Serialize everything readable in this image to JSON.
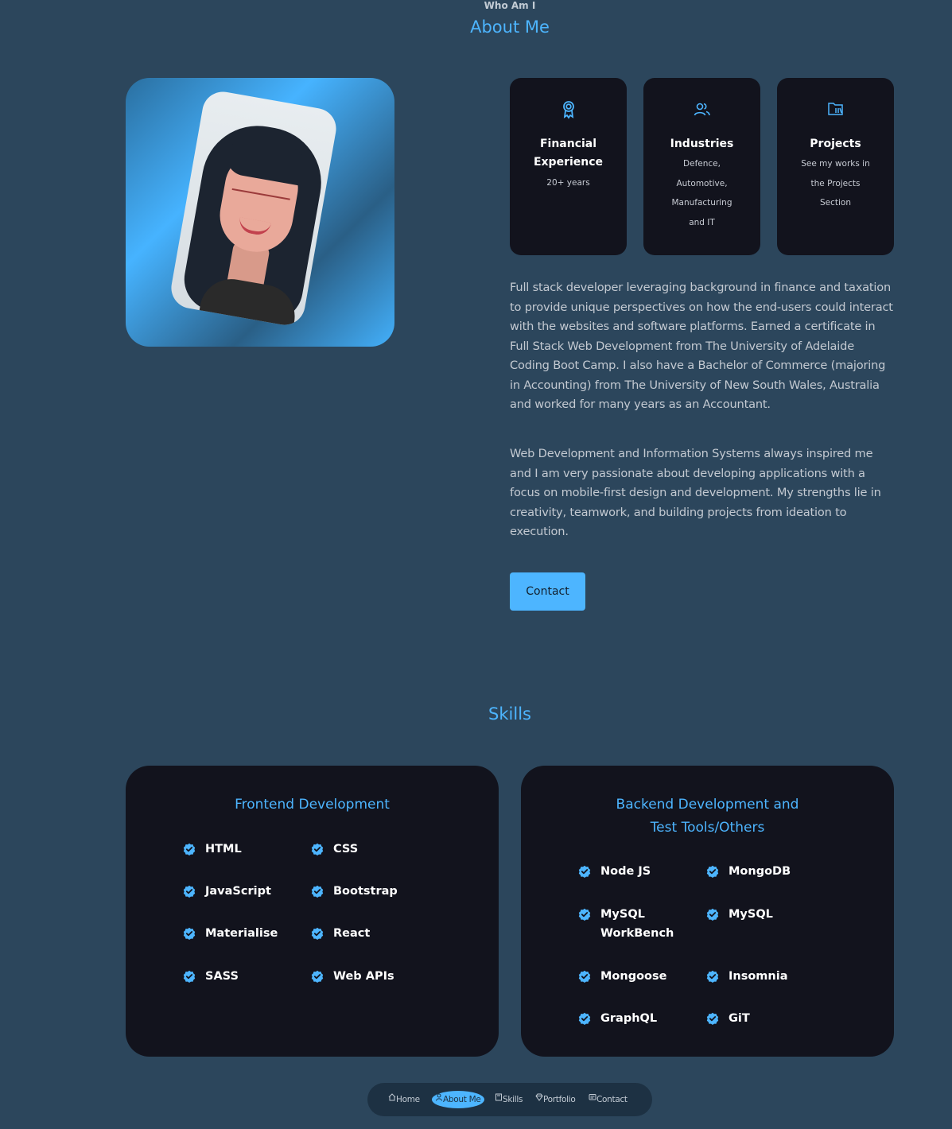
{
  "header": {
    "eyebrow": "Who Am I",
    "title": "About Me"
  },
  "info_cards": [
    {
      "icon": "award-icon",
      "title": "Financial Experience",
      "title_lines": [
        "Financial",
        "Experience"
      ],
      "subtitle": "20+ years",
      "subtitle_lines": [
        "20+ years"
      ]
    },
    {
      "icon": "users-icon",
      "title": "Industries",
      "title_lines": [
        "Industries"
      ],
      "subtitle": "Defence, Automotive, Manufacturing and IT",
      "subtitle_lines": [
        "Defence,",
        "Automotive,",
        "Manufacturing",
        "and IT"
      ]
    },
    {
      "icon": "folder-icon",
      "title": "Projects",
      "title_lines": [
        "Projects"
      ],
      "subtitle": "See my works in the Projects Section",
      "subtitle_lines": [
        "See my works in",
        "the Projects",
        "Section"
      ]
    }
  ],
  "about": {
    "paragraph_1": "Full stack developer leveraging background in finance and taxation to provide unique perspectives on how the end-users could interact with the websites and software platforms. Earned a certificate in Full Stack Web Development from The University of Adelaide Coding Boot Camp. I also have a Bachelor of Commerce (majoring in Accounting) from The University of New South Wales, Australia and worked for many years as an Accountant.",
    "paragraph_2": "Web Development and Information Systems always inspired me and I am very passionate about developing applications with a focus on mobile-first design and development. My strengths lie in creativity, teamwork, and building projects from ideation to execution.",
    "contact_label": "Contact"
  },
  "skills": {
    "title": "Skills",
    "frontend": {
      "heading": "Frontend Development",
      "items": [
        "HTML",
        "CSS",
        "JavaScript",
        "Bootstrap",
        "Materialise",
        "React",
        "SASS",
        "Web APIs"
      ]
    },
    "backend": {
      "heading": "Backend Development and Test Tools/Others",
      "items": [
        "Node JS",
        "MongoDB",
        "MySQL WorkBench",
        "MySQL",
        "Mongoose",
        "Insomnia",
        "GraphQL",
        "GiT"
      ]
    }
  },
  "nav": {
    "items": [
      {
        "label": "Home",
        "icon": "home-icon",
        "active": false
      },
      {
        "label": "About Me",
        "icon": "user-icon",
        "active": true
      },
      {
        "label": "Skills",
        "icon": "book-icon",
        "active": false
      },
      {
        "label": "Portfolio",
        "icon": "diamond-icon",
        "active": false
      },
      {
        "label": "Contact",
        "icon": "message-icon",
        "active": false
      }
    ]
  },
  "colors": {
    "background": "#2c465c",
    "accent": "#4db5ff",
    "card": "#12131d"
  }
}
